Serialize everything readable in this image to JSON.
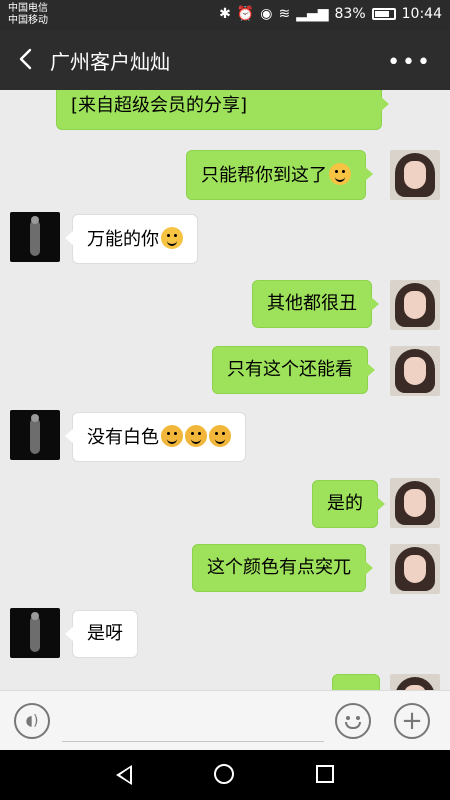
{
  "status_bar": {
    "carrier1": "中国电信",
    "carrier2": "中国移动",
    "battery": "83%",
    "time": "10:44"
  },
  "header": {
    "title": "广州客户灿灿"
  },
  "messages": [
    {
      "text": "[来自超级会员的分享]",
      "side": "right"
    },
    {
      "text": "只能帮你到这了",
      "side": "right"
    },
    {
      "text": "万能的你",
      "side": "left"
    },
    {
      "text": "其他都很丑",
      "side": "right"
    },
    {
      "text": "只有这个还能看",
      "side": "right"
    },
    {
      "text": "没有白色",
      "side": "left"
    },
    {
      "text": "是的",
      "side": "right"
    },
    {
      "text": "这个颜色有点突兀",
      "side": "right"
    },
    {
      "text": "是呀",
      "side": "left"
    }
  ]
}
